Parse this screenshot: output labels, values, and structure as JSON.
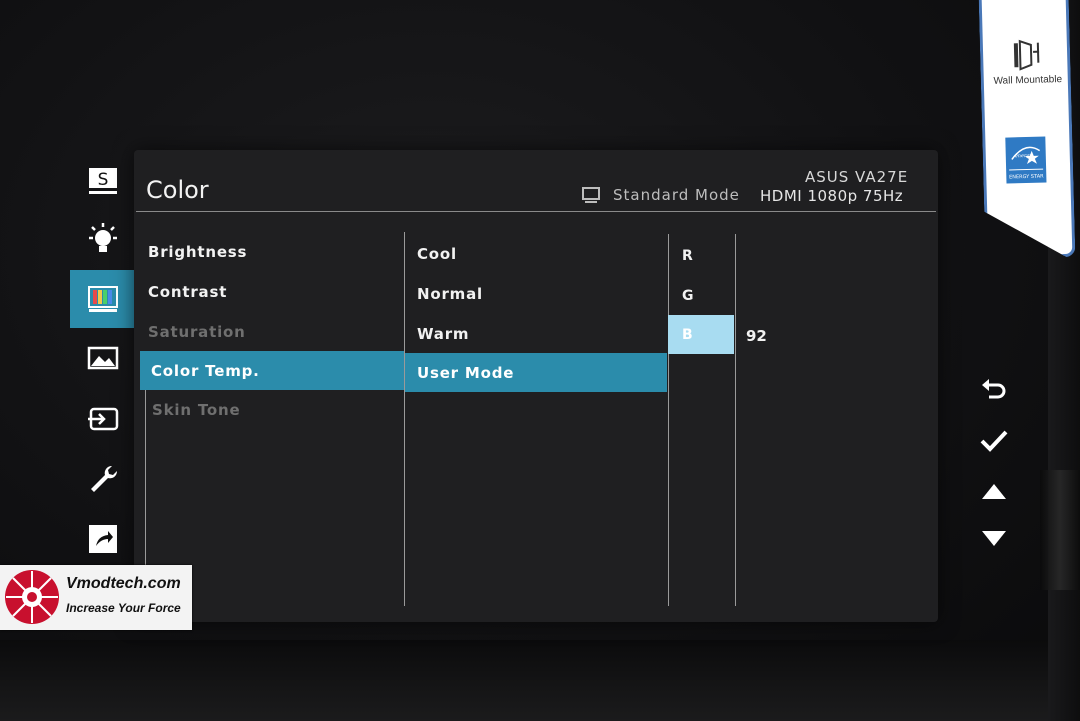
{
  "monitor": {
    "model": "ASUS VA27E",
    "sticker": {
      "wall_label": "Wall Mountable",
      "energy_label": "ENERGY STAR",
      "energy_script": "energy"
    }
  },
  "osd": {
    "title": "Color",
    "mode": {
      "icon": "monitor-icon",
      "label": "Standard Mode"
    },
    "signal": "HDMI  1080p 75Hz",
    "tabs": [
      {
        "icon": "splendid-icon",
        "glyph": "S",
        "active": false
      },
      {
        "icon": "blue-light-filter-icon",
        "active": false
      },
      {
        "icon": "color-icon",
        "active": true
      },
      {
        "icon": "image-icon",
        "active": false
      },
      {
        "icon": "input-select-icon",
        "active": false
      },
      {
        "icon": "system-setup-icon",
        "active": false
      },
      {
        "icon": "shortcut-icon",
        "active": false
      }
    ],
    "level1": [
      {
        "label": "Brightness",
        "enabled": true,
        "selected": false
      },
      {
        "label": "Contrast",
        "enabled": true,
        "selected": false
      },
      {
        "label": "Saturation",
        "enabled": false,
        "selected": false
      },
      {
        "label": "Color Temp.",
        "enabled": true,
        "selected": true
      },
      {
        "label": "Skin Tone",
        "enabled": false,
        "selected": false
      }
    ],
    "level2": [
      {
        "label": "Cool",
        "selected": false
      },
      {
        "label": "Normal",
        "selected": false
      },
      {
        "label": "Warm",
        "selected": false
      },
      {
        "label": "User Mode",
        "selected": true
      }
    ],
    "channels": [
      {
        "label": "R",
        "selected": false
      },
      {
        "label": "G",
        "selected": false
      },
      {
        "label": "B",
        "selected": true
      }
    ],
    "selected_value": "92",
    "nav_icons": [
      "back-icon",
      "confirm-icon",
      "up-arrow-icon",
      "down-arrow-icon"
    ],
    "accent": "#2b8cab",
    "highlight": "#a8dcf1"
  },
  "watermark": {
    "site": "Vmodtech.com",
    "tagline": "Increase Your Force"
  }
}
